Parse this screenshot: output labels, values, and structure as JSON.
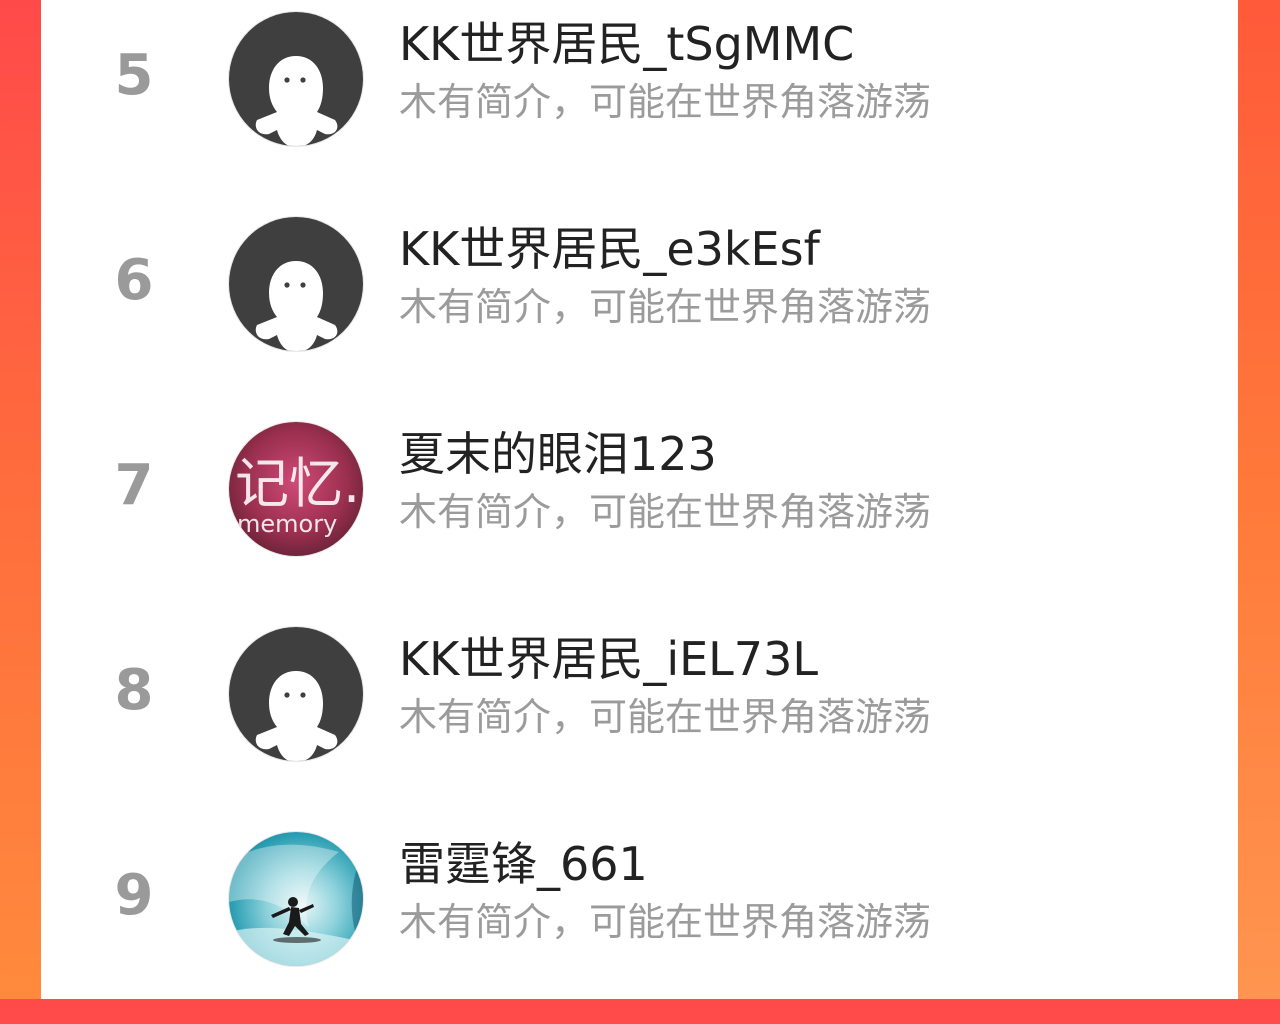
{
  "colors": {
    "background_gradient_top": "#ff4a4a",
    "background_gradient_bottom": "#ff8a3d",
    "rank_color": "#9a9a9a",
    "name_color": "#222222",
    "bio_color": "#9b9b9b"
  },
  "list": {
    "items": [
      {
        "rank": "5",
        "name": "KK世界居民_tSgMMC",
        "bio": "木有简介，可能在世界角落游荡",
        "avatar": "default-ghost-avatar"
      },
      {
        "rank": "6",
        "name": "KK世界居民_e3kEsf",
        "bio": "木有简介，可能在世界角落游荡",
        "avatar": "default-ghost-avatar"
      },
      {
        "rank": "7",
        "name": "夏末的眼泪123",
        "bio": "木有简介，可能在世界角落游荡",
        "avatar": "memory-text-avatar",
        "avatar_text_cn": "记忆.",
        "avatar_text_en": "memory"
      },
      {
        "rank": "8",
        "name": "KK世界居民_iEL73L",
        "bio": "木有简介，可能在世界角落游荡",
        "avatar": "default-ghost-avatar"
      },
      {
        "rank": "9",
        "name": "雷霆锋_661",
        "bio": "木有简介，可能在世界角落游荡",
        "avatar": "surfer-wave-avatar"
      }
    ]
  }
}
